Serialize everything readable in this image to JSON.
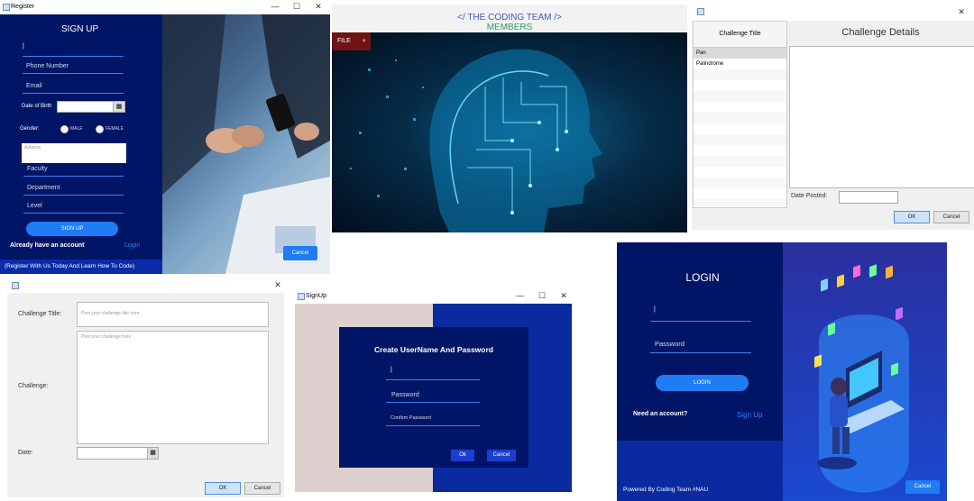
{
  "register": {
    "window_title": "Register",
    "heading": "SIGN UP",
    "fields": {
      "phone": "Phone Number",
      "email": "Email",
      "dob_label": "Date of Birth",
      "gender_label": "Gender:",
      "male": "MALE",
      "female": "FEMALE",
      "address": "Address",
      "faculty": "Faculty",
      "department": "Department",
      "level": "Level"
    },
    "signup_button": "SIGN UP",
    "have_account": "Already have an account",
    "login_link": "Login",
    "cancel_button": "Cancel",
    "footer": "(Register With Us Today And Learn How To Code)"
  },
  "members": {
    "title": "</ THE CODING TEAM />",
    "subtitle": "MEMBERS",
    "menu_file": "FILE"
  },
  "challenges": {
    "column_header": "Challenge Title",
    "items": [
      "Pan",
      "Palindrome"
    ],
    "details_title": "Challenge Details",
    "date_posted_label": "Date Posted:",
    "ok_button": "OK",
    "cancel_button": "Cancel"
  },
  "post_challenge": {
    "title_label": "Challenge Title:",
    "title_placeholder": "Post your challenge title here",
    "challenge_label": "Challenge:",
    "challenge_placeholder": "Post your challenge here",
    "date_label": "Date:",
    "ok_button": "OK",
    "cancel_button": "Cancel"
  },
  "create_credentials": {
    "window_title": "SignUp",
    "heading": "Create UserName And Password",
    "password": "Password",
    "confirm_password": "Confirm Password",
    "ok_button": "Ok",
    "cancel_button": "Cancel"
  },
  "login": {
    "heading": "LOGIN",
    "password": "Password",
    "login_button": "LOGIN",
    "need_account": "Need an account?",
    "signup_link": "Sign Up",
    "footer": "Powered By Coding Team #NAU",
    "cancel_button": "Cancel"
  },
  "colors": {
    "navy": "#011566",
    "accent_blue": "#1f7cf5",
    "dark_red_menu": "#6e1414"
  }
}
